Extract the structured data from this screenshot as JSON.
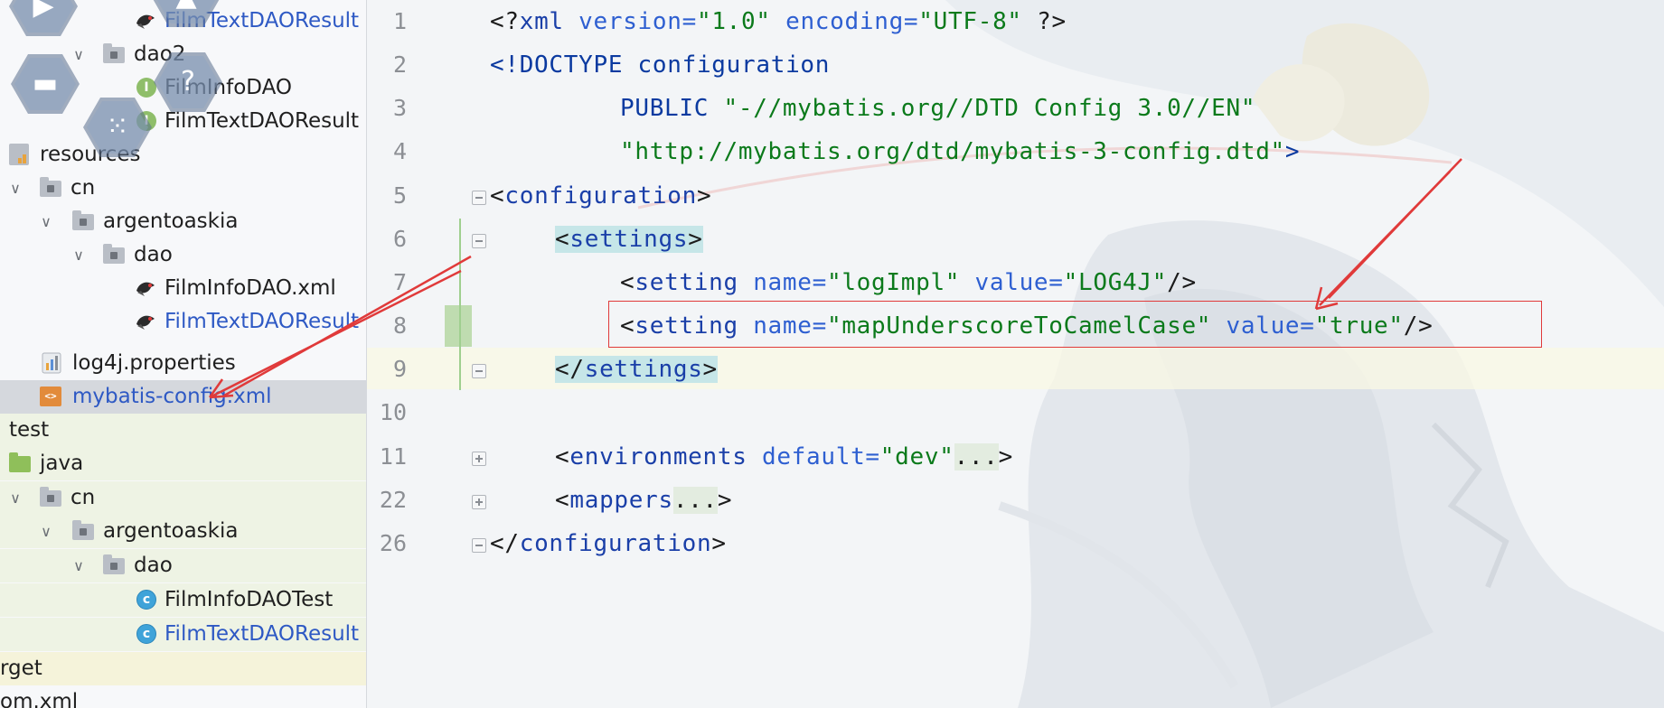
{
  "overlay": {
    "icons": [
      "play-icon",
      "image-icon",
      "folder-icon",
      "help-icon",
      "apps-grid-icon"
    ]
  },
  "tree": {
    "rows": [
      {
        "label": "FilmTextDAOResult",
        "icon": "mybatis-bird-icon",
        "vcs": true
      },
      {
        "label": "dao2",
        "icon": "package-folder-icon",
        "expanded": true
      },
      {
        "label": "FilmInfoDAO",
        "icon": "interface-icon"
      },
      {
        "label": "FilmTextDAOResult",
        "icon": "interface-icon"
      },
      {
        "label": "resources",
        "icon": "resources-folder-icon"
      },
      {
        "label": "cn",
        "icon": "package-folder-icon",
        "expanded": true
      },
      {
        "label": "argentoaskia",
        "icon": "package-folder-icon",
        "expanded": true
      },
      {
        "label": "dao",
        "icon": "package-folder-icon",
        "expanded": true
      },
      {
        "label": "FilmInfoDAO.xml",
        "icon": "mybatis-bird-icon"
      },
      {
        "label": "FilmTextDAOResult",
        "icon": "mybatis-bird-icon",
        "vcs": true
      },
      {
        "label": "log4j.properties",
        "icon": "properties-file-icon"
      },
      {
        "label": "mybatis-config.xml",
        "icon": "xml-file-icon",
        "vcs": true,
        "selected": true
      },
      {
        "label": "test",
        "icon": "none"
      },
      {
        "label": "java",
        "icon": "test-source-folder-icon"
      },
      {
        "label": "cn",
        "icon": "package-folder-icon",
        "expanded": true
      },
      {
        "label": "argentoaskia",
        "icon": "package-folder-icon",
        "expanded": true
      },
      {
        "label": "dao",
        "icon": "package-folder-icon",
        "expanded": true
      },
      {
        "label": "FilmInfoDAOTest",
        "icon": "test-class-icon"
      },
      {
        "label": "FilmTextDAOResult",
        "icon": "test-class-icon",
        "vcs": true
      },
      {
        "label": "rget",
        "icon": "none"
      },
      {
        "label": "om.xml",
        "icon": "none"
      }
    ]
  },
  "editor": {
    "line_numbers": [
      "1",
      "2",
      "3",
      "4",
      "5",
      "6",
      "7",
      "8",
      "9",
      "10",
      "11",
      "22",
      "26"
    ],
    "lines": {
      "l1": {
        "p1": "<?",
        "p2": "xml",
        "p3": " version=",
        "p4": "\"1.0\"",
        "p5": " encoding=",
        "p6": "\"UTF-8\"",
        "p7": " ?>"
      },
      "l2": {
        "p1": "<!DOCTYPE configuration"
      },
      "l3": {
        "p1": "PUBLIC ",
        "p2": "\"-//mybatis.org//DTD Config 3.0//EN\""
      },
      "l4": {
        "p1": "\"http://mybatis.org/dtd/mybatis-3-config.dtd\"",
        "p2": ">"
      },
      "l5": {
        "p1": "<",
        "p2": "configuration",
        "p3": ">"
      },
      "l6": {
        "p1": "<",
        "p2": "settings",
        "p3": ">"
      },
      "l7": {
        "p1": "<",
        "p2": "setting",
        "p3": " name=",
        "p4": "\"logImpl\"",
        "p5": " value=",
        "p6": "\"LOG4J\"",
        "p7": "/>"
      },
      "l8": {
        "p1": "<",
        "p2": "setting",
        "p3": " name=",
        "p4": "\"mapUnderscoreToCamelCase\"",
        "p5": " value=",
        "p6": "\"true\"",
        "p7": "/>"
      },
      "l9": {
        "p1": "</",
        "p2": "settings",
        "p3": ">"
      },
      "l11": {
        "p1": "<",
        "p2": "environments",
        "p3": " default=",
        "p4": "\"dev\"",
        "p5": "...",
        "p6": ">"
      },
      "l22": {
        "p1": "<",
        "p2": "mappers",
        "p3": "...",
        "p4": ">"
      },
      "l26": {
        "p1": "</",
        "p2": "configuration",
        "p3": ">"
      }
    }
  },
  "colors": {
    "annotation_red": "#e03a3a",
    "tag_blue": "#1a3fa8",
    "string_green": "#0b7a1b",
    "vcs_modified_blue": "#2e59c4"
  }
}
